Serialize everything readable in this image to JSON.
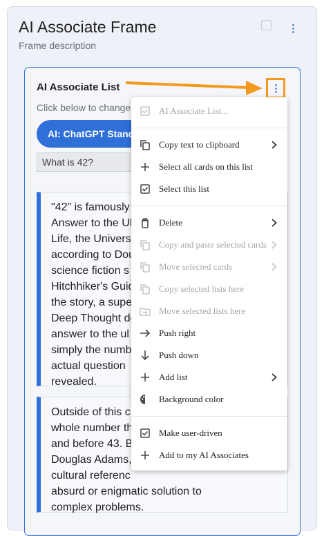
{
  "frame": {
    "title": "AI Associate Frame",
    "description": "Frame description"
  },
  "list": {
    "title": "AI Associate List",
    "hint": "Click below to change",
    "model_button": "AI: ChatGPT Standa",
    "query": "What is 42?"
  },
  "cards": [
    {
      "text": "\"42\" is famously\nAnswer to the Ul\nLife, the Univers\naccording to Dou\nscience fiction s\nHitchhiker's Guid\nthe story, a supe\nDeep Thought de\nanswer to the ul\nsimply the numb\nactual question\nrevealed."
    },
    {
      "text": "Outside of this c\nwhole number th\nand before 43. B\nDouglas Adams,\ncultural referenc\nabsurd or enigmatic solution to\ncomplex problems."
    }
  ],
  "menu": {
    "items": [
      {
        "label": "AI Associate List...",
        "icon": "checkbox-checked-icon",
        "disabled": true,
        "submenu": false
      },
      {
        "label": "Copy text to clipboard",
        "icon": "copy-icon",
        "disabled": false,
        "submenu": true
      },
      {
        "label": "Select all cards on this list",
        "icon": "plus-icon",
        "disabled": false,
        "submenu": false
      },
      {
        "label": "Select this list",
        "icon": "checkbox-checked-icon",
        "disabled": false,
        "submenu": false
      },
      {
        "label": "Delete",
        "icon": "trash-icon",
        "disabled": false,
        "submenu": true
      },
      {
        "label": "Copy and paste selected cards",
        "icon": "copy-icon",
        "disabled": true,
        "submenu": true
      },
      {
        "label": "Move selected cards",
        "icon": "copy-icon",
        "disabled": true,
        "submenu": true
      },
      {
        "label": "Copy selected lists here",
        "icon": "copy-icon",
        "disabled": true,
        "submenu": false
      },
      {
        "label": "Move selected lists here",
        "icon": "folder-move-icon",
        "disabled": true,
        "submenu": false
      },
      {
        "label": "Push right",
        "icon": "arrow-right-icon",
        "disabled": false,
        "submenu": false
      },
      {
        "label": "Push down",
        "icon": "arrow-down-icon",
        "disabled": false,
        "submenu": false
      },
      {
        "label": "Add list",
        "icon": "plus-icon",
        "disabled": false,
        "submenu": true
      },
      {
        "label": "Background color",
        "icon": "palette-icon",
        "disabled": false,
        "submenu": false
      },
      {
        "label": "Make user-driven",
        "icon": "checkbox-checked-icon",
        "disabled": false,
        "submenu": false
      },
      {
        "label": "Add to my AI Associates",
        "icon": "plus-icon",
        "disabled": false,
        "submenu": false
      }
    ]
  },
  "colors": {
    "accent": "#2f6fd8",
    "annotation": "#f39a1e",
    "disabled": "#a5a5a5"
  }
}
